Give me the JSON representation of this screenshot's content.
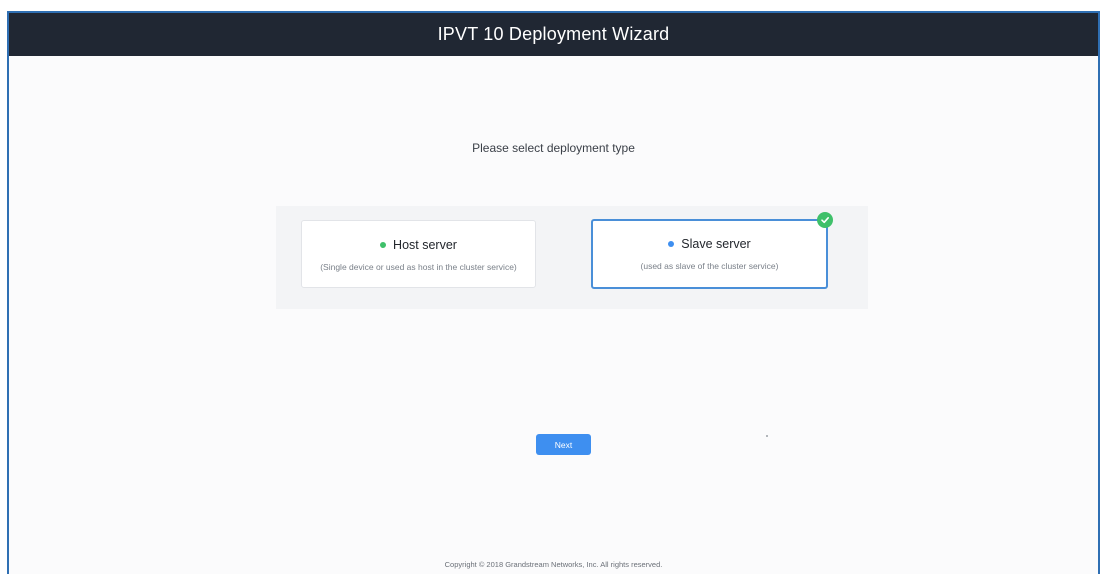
{
  "app": {
    "title": "IPVT 10 Deployment Wizard"
  },
  "prompt": "Please select deployment type",
  "options": [
    {
      "label": "Host server",
      "description": "(Single device or used as host in the cluster service)",
      "dot_color": "#3fc06a",
      "selected": false
    },
    {
      "label": "Slave server",
      "description": "(used as slave of the cluster service)",
      "dot_color": "#3e8ff0",
      "selected": true
    }
  ],
  "selected_icon": "check-icon",
  "next_button": {
    "label": "Next"
  },
  "footer": {
    "copyright": "Copyright © 2018 Grandstream Networks, Inc. All rights reserved."
  },
  "colors": {
    "header_bg": "#202733",
    "accent": "#3e8ff0",
    "selected_border": "#4a8fd8",
    "check": "#3fc06a"
  }
}
